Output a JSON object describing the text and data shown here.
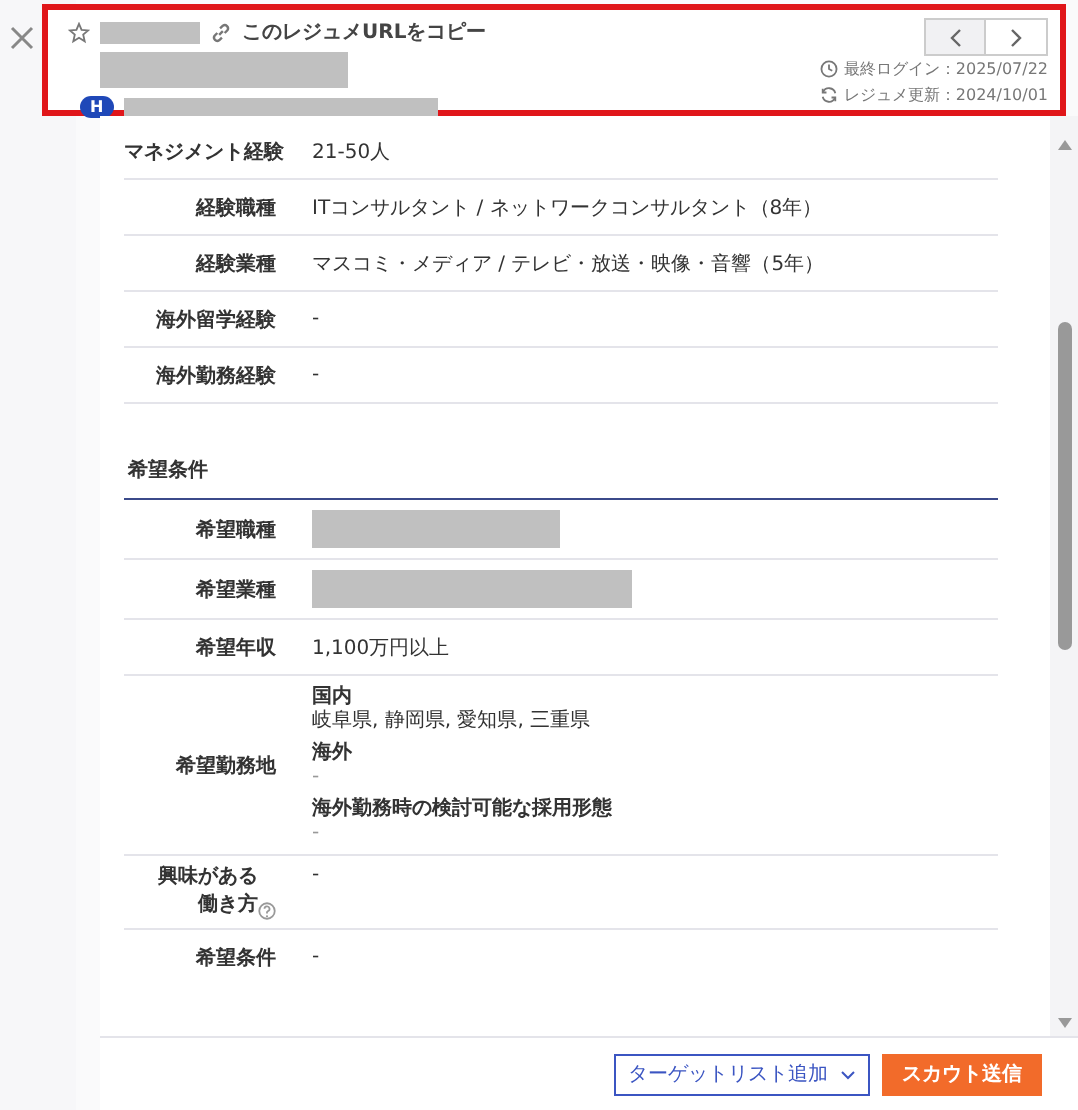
{
  "header": {
    "copy_link": "このレジュメURLをコピー",
    "badge": "H",
    "last_login": "最終ログイン：2025/07/22",
    "resume_updated": "レジュメ更新：2024/10/01"
  },
  "profile_rows": [
    {
      "label": "マネジメント経験",
      "value": "21-50人"
    },
    {
      "label": "経験職種",
      "value": "ITコンサルタント / ネットワークコンサルタント（8年）"
    },
    {
      "label": "経験業種",
      "value": "マスコミ・メディア / テレビ・放送・映像・音響（5年）"
    },
    {
      "label": "海外留学経験",
      "value": "-"
    },
    {
      "label": "海外勤務経験",
      "value": "-"
    }
  ],
  "section_title": "希望条件",
  "desired_rows": [
    {
      "kind": "redacted",
      "label": "希望職種"
    },
    {
      "kind": "redacted",
      "label": "希望業種"
    },
    {
      "kind": "text",
      "label": "希望年収",
      "value": "1,100万円以上"
    },
    {
      "kind": "groups",
      "label": "希望勤務地",
      "groups": [
        {
          "heading": "国内",
          "value": "岐阜県, 静岡県, 愛知県, 三重県"
        },
        {
          "heading": "海外",
          "value": "-"
        },
        {
          "heading": "海外勤務時の検討可能な採用形態",
          "value": "-"
        }
      ]
    },
    {
      "kind": "help",
      "label": "興味がある働き方",
      "value": "-"
    },
    {
      "kind": "text",
      "label": "希望条件",
      "value": "-"
    }
  ],
  "footer": {
    "target_button": "ターゲットリスト追加",
    "scout_button": "スカウト送信"
  }
}
